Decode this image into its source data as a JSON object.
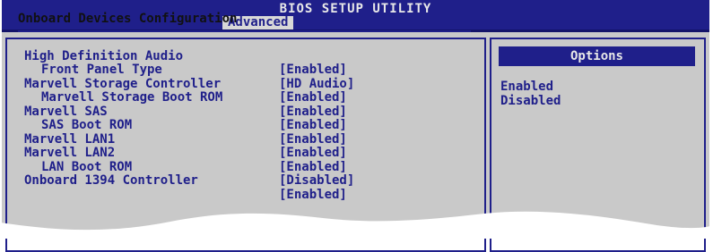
{
  "window": {
    "title": "BIOS SETUP UTILITY",
    "active_tab": "Advanced"
  },
  "section": {
    "title": "Onboard Devices Configuration"
  },
  "settings": [
    {
      "label": "High Definition Audio",
      "value": "[Enabled]",
      "indent": false
    },
    {
      "label": "Front Panel Type",
      "value": "[HD Audio]",
      "indent": true
    },
    {
      "label": "Marvell Storage Controller",
      "value": "[Enabled]",
      "indent": false
    },
    {
      "label": "Marvell Storage Boot ROM",
      "value": "[Enabled]",
      "indent": true
    },
    {
      "label": "Marvell SAS",
      "value": "[Enabled]",
      "indent": false
    },
    {
      "label": "SAS Boot ROM",
      "value": "[Enabled]",
      "indent": true
    },
    {
      "label": "Marvell LAN1",
      "value": "[Enabled]",
      "indent": false
    },
    {
      "label": "Marvell LAN2",
      "value": "[Enabled]",
      "indent": false
    },
    {
      "label": "LAN Boot ROM",
      "value": "[Disabled]",
      "indent": true
    },
    {
      "label": "Onboard 1394 Controller",
      "value": "[Enabled]",
      "indent": false
    }
  ],
  "options_panel": {
    "header": "Options",
    "items": [
      "Enabled",
      "Disabled"
    ]
  },
  "colors": {
    "bios_blue": "#1f1f8a",
    "panel_grey": "#c9c9c9",
    "tab_highlight": "#d8d8d8"
  }
}
